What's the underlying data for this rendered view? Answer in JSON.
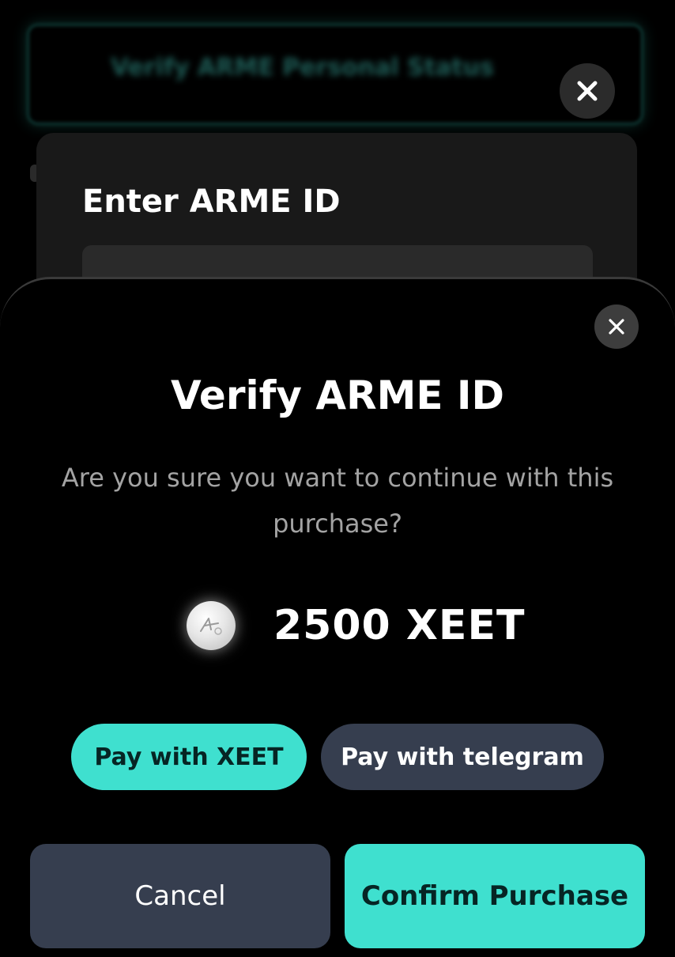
{
  "background": {
    "banner_text": "Verify ARME Personal Status",
    "card_title": "Enter ARME ID",
    "close_icon": "close-icon"
  },
  "modal": {
    "title": "Verify ARME ID",
    "question": "Are you sure you want to continue with this purchase?",
    "price": "2500 XEET",
    "coin_icon": "xeet-coin-icon",
    "pay_options": {
      "xeet": "Pay with XEET",
      "telegram": "Pay with telegram"
    },
    "actions": {
      "cancel": "Cancel",
      "confirm": "Confirm Purchase"
    }
  },
  "colors": {
    "accent": "#3fe0cf",
    "secondary_button": "#363e4f",
    "background": "#000000"
  }
}
